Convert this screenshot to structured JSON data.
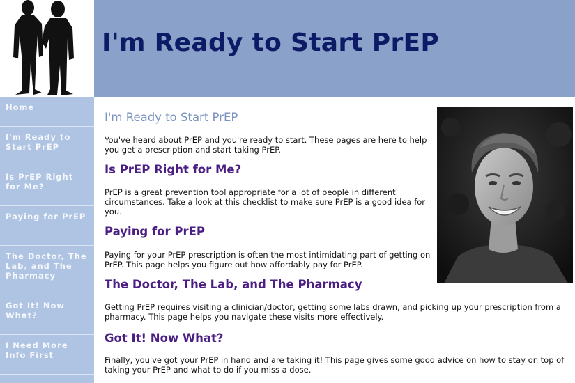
{
  "site": {
    "title": "I'm Ready to Start PrEP"
  },
  "colors": {
    "banner": "#8aa1c9",
    "title": "#0d1a66",
    "sidebar": "#afc3e3",
    "nav_text": "#f4f7fc",
    "page_heading": "#7a93c0",
    "section_heading": "#4a1e83"
  },
  "nav": {
    "items": [
      {
        "label": "Home"
      },
      {
        "label": "I'm Ready to Start PrEP"
      },
      {
        "label": "Is PrEP Right for Me?"
      },
      {
        "label": "Paying for PrEP"
      },
      {
        "label": "The Doctor, The Lab, and The Pharmacy"
      },
      {
        "label": "Got It! Now What?"
      },
      {
        "label": "I Need More Info First"
      }
    ]
  },
  "main": {
    "heading": "I'm Ready to Start PrEP",
    "intro": "You've heard about PrEP and you're ready to start. These pages are here to help you get a prescription and start taking PrEP.",
    "sections": [
      {
        "title": "Is PrEP Right for Me?",
        "body": "PrEP is a great prevention tool appropriate for a lot of people in different circumstances. Take a look at this checklist to make sure PrEP is a good idea for you."
      },
      {
        "title": "Paying for PrEP",
        "body": "Paying for your PrEP prescription is often the most intimidating part of getting on PrEP. This page helps you figure out how affordably pay for PrEP."
      },
      {
        "title": "The Doctor, The Lab, and The Pharmacy",
        "body": "Getting PrEP requires visiting a clinician/doctor, getting some labs drawn, and picking up your prescription from a pharmacy. This page helps you navigate these visits more effectively."
      },
      {
        "title": "Got It! Now What?",
        "body": "Finally, you've got your PrEP in hand and are taking it! This page gives some good advice on how to stay on top of taking your PrEP and what to do if you miss a dose."
      }
    ]
  },
  "images": {
    "logo": "two-men-silhouette",
    "hero": "smiling-young-man-photo"
  }
}
